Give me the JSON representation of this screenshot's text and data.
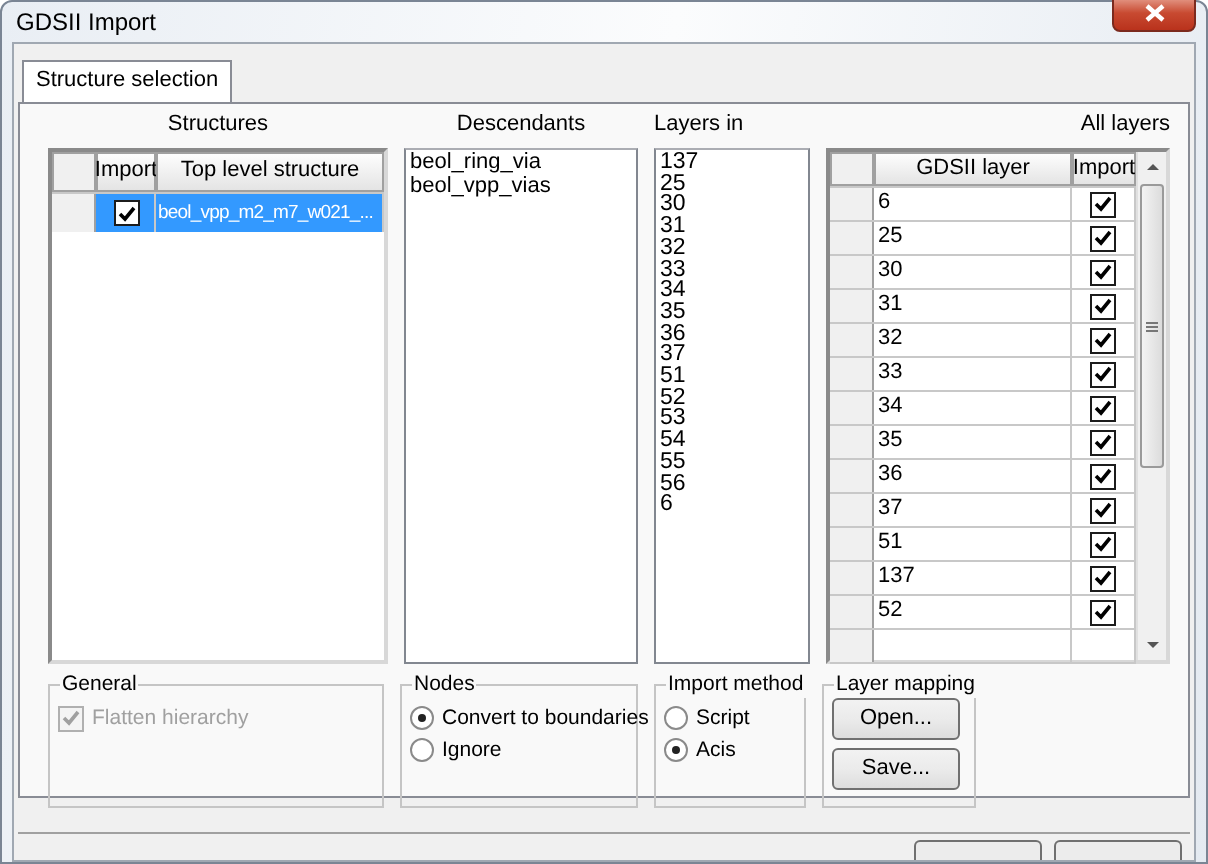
{
  "window": {
    "title": "GDSII Import"
  },
  "tabs": [
    {
      "label": "Structure selection",
      "selected": true
    }
  ],
  "structures": {
    "heading": "Structures",
    "columns": [
      "Import",
      "Top level structure"
    ],
    "rows": [
      {
        "import": true,
        "name": "beol_vpp_m2_m7_w021_...",
        "selected": true
      }
    ]
  },
  "descendants": {
    "heading": "Descendants",
    "items": [
      "beol_ring_via",
      "beol_vpp_vias"
    ]
  },
  "layers_in": {
    "heading": "Layers in",
    "items": [
      "137",
      "25",
      "30",
      "31",
      "32",
      "33",
      "34",
      "35",
      "36",
      "37",
      "51",
      "52",
      "53",
      "54",
      "55",
      "56",
      "6"
    ]
  },
  "all_layers": {
    "heading": "All layers",
    "columns": [
      "GDSII layer",
      "Import"
    ],
    "rows": [
      {
        "layer": "6",
        "import": true
      },
      {
        "layer": "25",
        "import": true
      },
      {
        "layer": "30",
        "import": true
      },
      {
        "layer": "31",
        "import": true
      },
      {
        "layer": "32",
        "import": true
      },
      {
        "layer": "33",
        "import": true
      },
      {
        "layer": "34",
        "import": true
      },
      {
        "layer": "35",
        "import": true
      },
      {
        "layer": "36",
        "import": true
      },
      {
        "layer": "37",
        "import": true
      },
      {
        "layer": "51",
        "import": true
      },
      {
        "layer": "137",
        "import": true
      },
      {
        "layer": "52",
        "import": true
      }
    ]
  },
  "general": {
    "title": "General",
    "options": [
      {
        "label": "Flatten hierarchy",
        "checked": true,
        "disabled": true
      }
    ]
  },
  "nodes": {
    "title": "Nodes",
    "options": [
      {
        "label": "Convert to boundaries",
        "selected": true
      },
      {
        "label": "Ignore",
        "selected": false
      }
    ]
  },
  "import_method": {
    "title": "Import method",
    "options": [
      {
        "label": "Script",
        "selected": false
      },
      {
        "label": "Acis",
        "selected": true
      }
    ]
  },
  "layer_mapping": {
    "title": "Layer mapping",
    "buttons": [
      "Open...",
      "Save..."
    ]
  }
}
